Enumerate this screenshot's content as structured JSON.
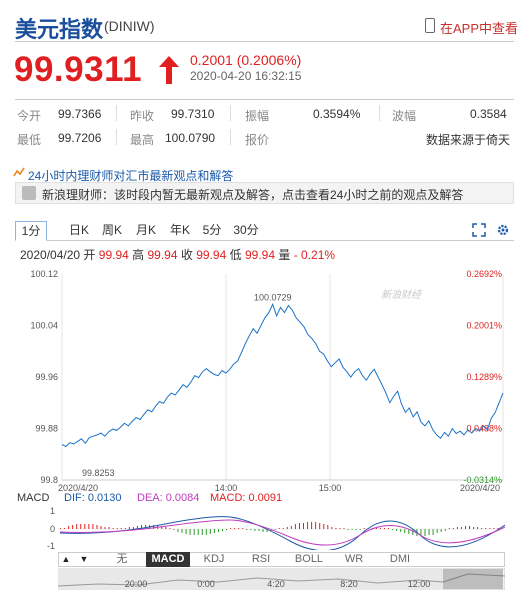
{
  "header": {
    "title": "美元指数",
    "code": "(DINIW)",
    "app_link": "在APP中查看"
  },
  "quote": {
    "price": "99.9311",
    "change": "0.2001 (0.2006%)",
    "timestamp": "2020-04-20 16:32:15",
    "stats": [
      {
        "label": "今开",
        "value": "99.7366"
      },
      {
        "label": "昨收",
        "value": "99.7310"
      },
      {
        "label": "振幅",
        "value": "0.3594%"
      },
      {
        "label": "波幅",
        "value": "0.3584"
      },
      {
        "label": "最低",
        "value": "99.7206"
      },
      {
        "label": "最高",
        "value": "100.0790"
      },
      {
        "label": "报价",
        "value": ""
      },
      {
        "label": "",
        "value": "数据来源于倚天"
      }
    ]
  },
  "news": {
    "headline": "24小时内理财师对汇市最新观点和解答",
    "item": "新浪理财师：该时段内暂无最新观点及解答，点击查看24小时之前的观点及解答"
  },
  "tabs": [
    "1分",
    "日K",
    "周K",
    "月K",
    "年K",
    "5分",
    "30分"
  ],
  "info": {
    "date": "2020/04/20",
    "open_label": "开",
    "open": "99.94",
    "high_label": "高",
    "high": "99.94",
    "close_label": "收",
    "close": "99.94",
    "low_label": "低",
    "low": "99.94",
    "vol_label": "量",
    "change": "- 0.21%"
  },
  "watermark": "新浪财经",
  "macd": {
    "label": "MACD",
    "dif": "DIF: 0.0130",
    "dea": "DEA: 0.0084",
    "macd": "MACD: 0.0091",
    "ticks": [
      "1",
      "0",
      "-1"
    ]
  },
  "indicators": [
    "无",
    "MACD",
    "KDJ",
    "RSI",
    "BOLL",
    "WR",
    "DMI"
  ],
  "nav_times": [
    "20:00",
    "0:00",
    "4:20",
    "8:20",
    "12:00"
  ],
  "colors": {
    "up": "#e02020",
    "down": "#2a9a2a",
    "line": "#1a73c8",
    "title": "#1a4e9c"
  },
  "chart_data": {
    "type": "line",
    "y_ticks": [
      "100.12",
      "100.04",
      "99.96",
      "99.88",
      "99.8"
    ],
    "pct_ticks": [
      "0.2692%",
      "0.2001%",
      "0.1289%",
      "0.0488%",
      "-0.0314%"
    ],
    "x_ticks": [
      "2020/4/20",
      "14:00",
      "15:00",
      "2020/4/20"
    ],
    "ylim": [
      99.8,
      100.12
    ],
    "annotations": [
      {
        "label": "100.0729"
      },
      {
        "label": "99.8253"
      }
    ],
    "series": [
      {
        "values": [
          99.855,
          99.852,
          99.858,
          99.856,
          99.86,
          99.864,
          99.857,
          99.866,
          99.868,
          99.87,
          99.873,
          99.868,
          99.875,
          99.879,
          99.877,
          99.882,
          99.888,
          99.884,
          99.891,
          99.897,
          99.894,
          99.902,
          99.909,
          99.906,
          99.915,
          99.922,
          99.919,
          99.929,
          99.935,
          99.932,
          99.94,
          99.948,
          99.944,
          99.952,
          99.962,
          99.959,
          99.968,
          99.973,
          99.968,
          99.964,
          99.962,
          99.97,
          99.966,
          99.972,
          99.98,
          99.985,
          99.998,
          100.012,
          100.024,
          100.035,
          100.028,
          100.04,
          100.052,
          100.06,
          100.073,
          100.055,
          100.068,
          100.06,
          100.071,
          100.064,
          100.052,
          100.045,
          100.038,
          100.026,
          100.02,
          100.012,
          100.0,
          99.996,
          99.985,
          99.976,
          99.982,
          99.988,
          99.975,
          99.968,
          99.96,
          99.968,
          99.973,
          99.962,
          99.955,
          99.965,
          99.972,
          99.96,
          99.948,
          99.935,
          99.92,
          99.93,
          99.938,
          99.918,
          99.905,
          99.912,
          99.898,
          99.906,
          99.89,
          99.884,
          99.892,
          99.878,
          99.87,
          99.865,
          99.874,
          99.868,
          99.88,
          99.872,
          99.876,
          99.87,
          99.878,
          99.873,
          99.88,
          99.876,
          99.884,
          99.878,
          99.896,
          99.905,
          99.92,
          99.935
        ]
      }
    ]
  }
}
